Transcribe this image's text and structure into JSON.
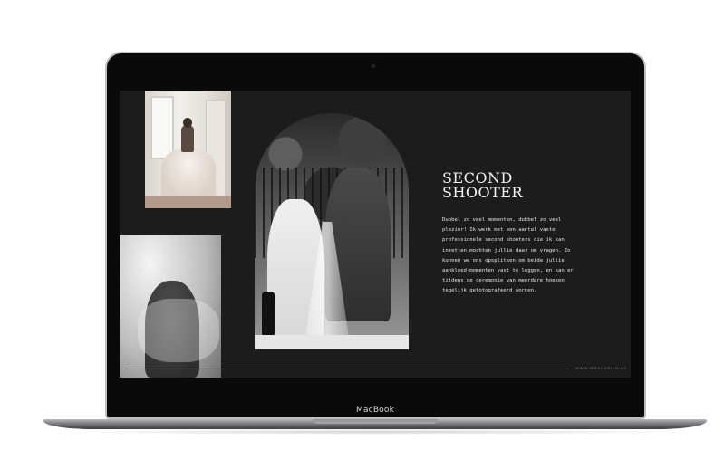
{
  "device": {
    "label": "MacBook"
  },
  "page": {
    "title_line1": "Second",
    "title_line2": "Shooter",
    "body": "Dubbel zo veel momenten, dubbel zo veel plezier! Ik werk met een aantal vaste professionele second shooters die ik kan inzetten mochten jullie daar om vragen. Zo kunnen we ons opsplitsen om beide jullie aankleed-momenten vast te leggen, en kan er tijdens de ceremonie van meerdere hoeken tegelijk gefotografeerd worden.",
    "footer_url": "WWW.MHCLARIJN.NL"
  },
  "colors": {
    "screen_bg": "#1c1c1c",
    "text": "#f2f2f2"
  }
}
